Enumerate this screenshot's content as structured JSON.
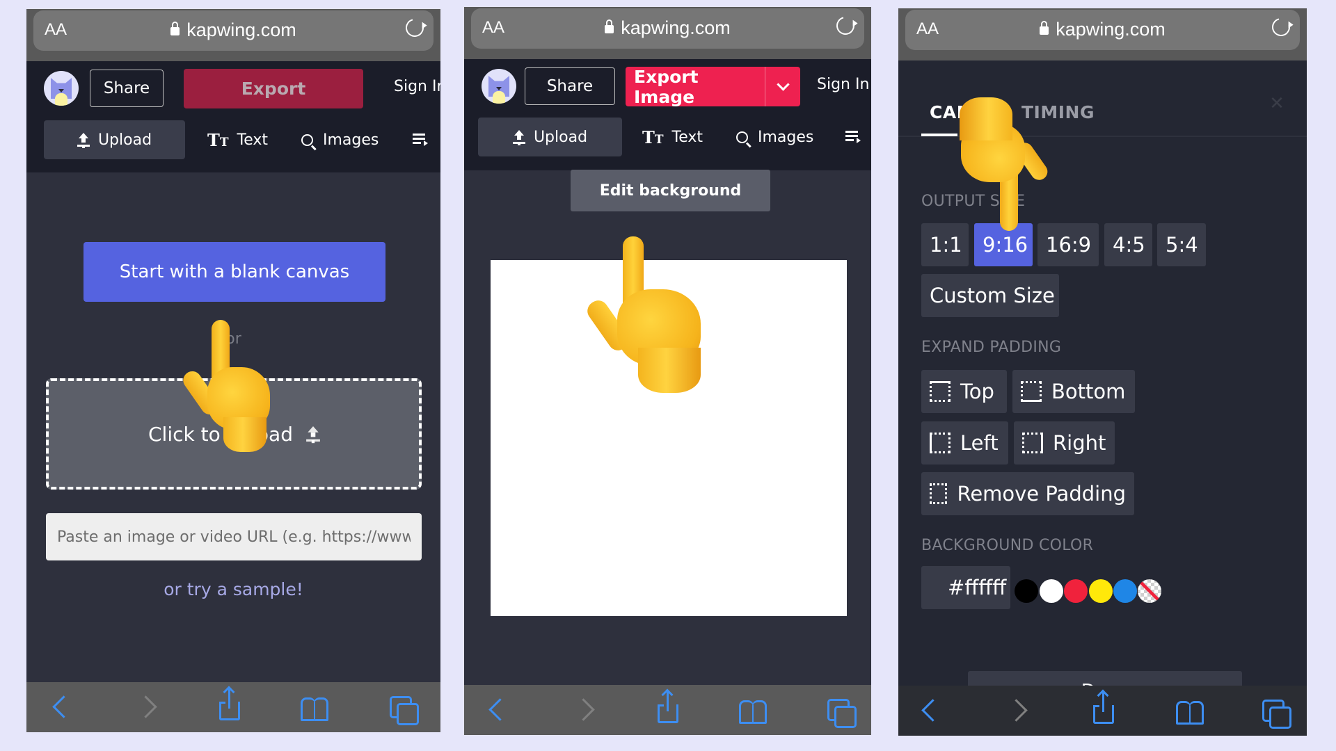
{
  "browser": {
    "text_size_label": "AA",
    "host": "kapwing.com",
    "lock_icon": "lock-icon",
    "reload_icon": "reload-icon",
    "bottom_toolbar": [
      "back-icon",
      "forward-icon",
      "share-icon",
      "bookmarks-icon",
      "tabs-icon"
    ]
  },
  "header": {
    "share_label": "Share",
    "export_label": "Export",
    "export_image_label": "Export Image",
    "sign_in_label": "Sign In",
    "tools": [
      {
        "label": "Upload",
        "icon": "upload-icon"
      },
      {
        "label": "Text",
        "icon": "text-icon"
      },
      {
        "label": "Images",
        "icon": "search-icon"
      },
      {
        "label": "",
        "icon": "playlist-icon"
      }
    ]
  },
  "panel1": {
    "blank_canvas_label": "Start with a blank canvas",
    "or_label": "or",
    "upload_zone_label": "Click to upload",
    "url_input_placeholder": "Paste an image or video URL (e.g. https://www.youtube.com/...)",
    "url_input_value": "",
    "sample_link": "or try a sample!"
  },
  "panel2": {
    "edit_background_label": "Edit background",
    "canvas_color": "#ffffff"
  },
  "panel3": {
    "tabs": [
      {
        "label": "CANVAS",
        "active": true
      },
      {
        "label": "TIMING",
        "active": false
      }
    ],
    "output_size_label": "OUTPUT SIZE",
    "output_sizes": [
      {
        "label": "1:1",
        "selected": false
      },
      {
        "label": "9:16",
        "selected": true
      },
      {
        "label": "16:9",
        "selected": false
      },
      {
        "label": "4:5",
        "selected": false
      },
      {
        "label": "5:4",
        "selected": false
      }
    ],
    "custom_size_label": "Custom Size",
    "expand_padding_label": "EXPAND PADDING",
    "padding_options": [
      "Top",
      "Bottom",
      "Left",
      "Right",
      "Remove Padding"
    ],
    "background_color_label": "BACKGROUND COLOR",
    "background_color_value": "#ffffff",
    "swatches": [
      "#000000",
      "#ffffff",
      "#f0223c",
      "#ffe80a",
      "#1f86e6",
      "transparent"
    ],
    "done_label": "Done"
  },
  "colors": {
    "accent_blue": "#5563e0",
    "export_red": "#ee2150",
    "export_red_disabled": "#9b1f3f",
    "link": "#a7a9e6",
    "safari_blue": "#3d8ef2"
  }
}
